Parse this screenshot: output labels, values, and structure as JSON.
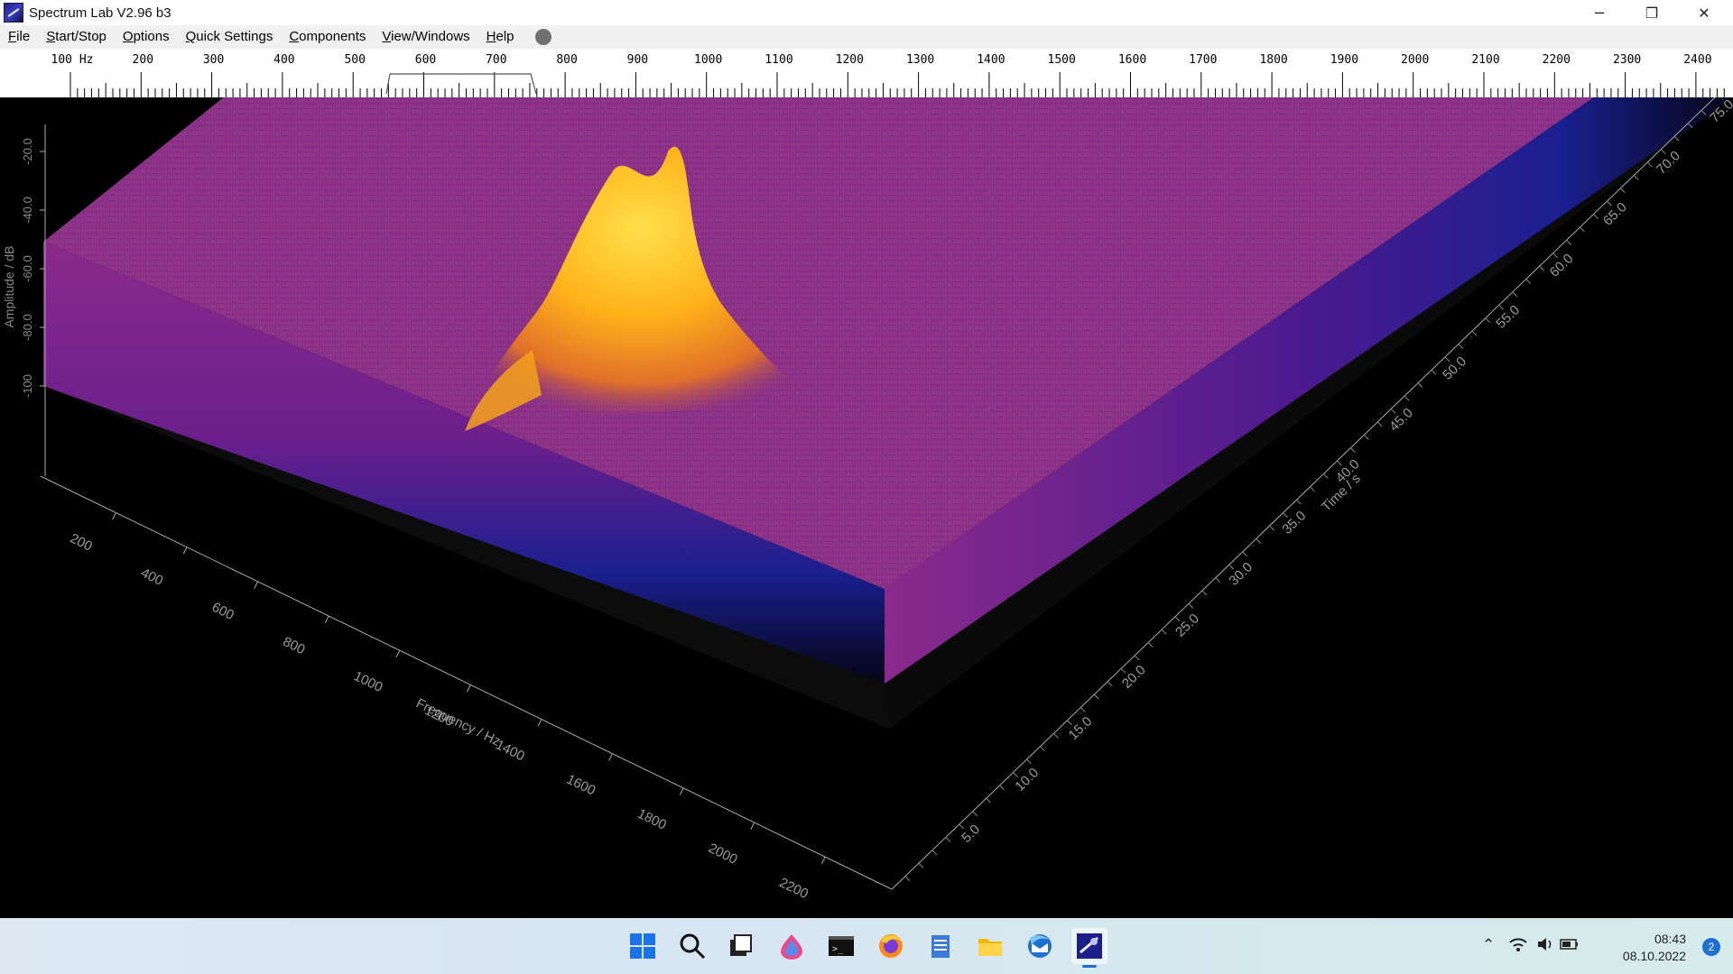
{
  "window": {
    "title": "Spectrum Lab V2.96 b3",
    "minimize_glyph": "─",
    "maximize_glyph": "❐",
    "close_glyph": "✕"
  },
  "menu": {
    "items": [
      "File",
      "Start/Stop",
      "Options",
      "Quick Settings",
      "Components",
      "View/Windows",
      "Help"
    ]
  },
  "frequency_scale": {
    "labels": [
      "100 Hz",
      "200",
      "300",
      "400",
      "500",
      "600",
      "700",
      "800",
      "900",
      "1000",
      "1100",
      "1200",
      "1300",
      "1400",
      "1500",
      "1600",
      "1700",
      "1800",
      "1900",
      "2000",
      "2100",
      "2200",
      "2300",
      "2400"
    ]
  },
  "waterfall_3d": {
    "amplitude_axis_label": "Amplitude / dB",
    "amplitude_ticks": [
      "-20.0",
      "-40.0",
      "-60.0",
      "-80.0",
      "-100"
    ],
    "frequency_axis_label": "Frequency / Hz",
    "frequency_ticks": [
      "200",
      "400",
      "600",
      "800",
      "1000",
      "1200",
      "1400",
      "1600",
      "1800",
      "2000",
      "2200"
    ],
    "time_axis_label": "Time / s",
    "time_ticks": [
      "5.0",
      "10.0",
      "15.0",
      "20.0",
      "25.0",
      "30.0",
      "35.0",
      "40.0",
      "45.0",
      "50.0",
      "55.0",
      "60.0",
      "65.0",
      "70.0",
      "75.0"
    ],
    "colors": {
      "noise_floor": "#8a2a8c",
      "peak": "#ffc21a",
      "base_blue": "#1a1f8f"
    }
  },
  "taskbar": {
    "icons": [
      "start-icon",
      "search-icon",
      "task-view-icon",
      "paint-icon",
      "terminal-icon",
      "firefox-icon",
      "notepad-icon",
      "file-explorer-icon",
      "thunderbird-icon",
      "spectrum-lab-icon"
    ],
    "clock_time": "08:43",
    "clock_date": "08.10.2022",
    "notification_count": "2"
  }
}
